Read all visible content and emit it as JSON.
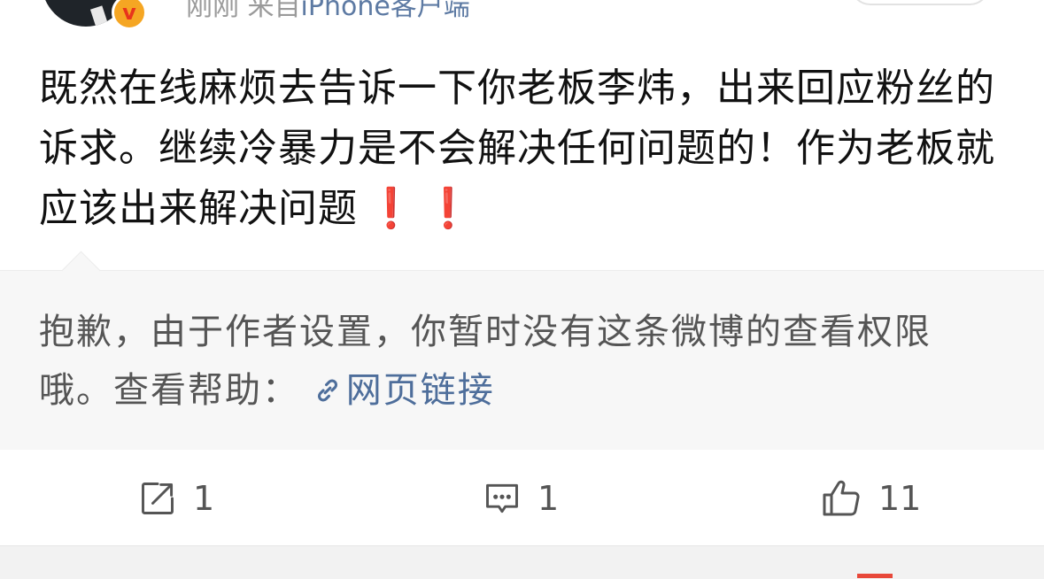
{
  "post": {
    "time": "刚刚",
    "source_prefix": "来自",
    "source": "iPhone客户端",
    "verified_mark": "v",
    "text": "既然在线麻烦去告诉一下你老板李炜，出来回应粉丝的诉求。继续冷暴力是不会解决任何问题的！作为老板就应该出来解决问题",
    "emoji": [
      "❗",
      "❗"
    ]
  },
  "notice": {
    "text": "抱歉，由于作者设置，你暂时没有这条微博的查看权限哦。查看帮助：",
    "link_label": "网页链接"
  },
  "actions": {
    "repost_count": "1",
    "comment_count": "1",
    "like_count": "11"
  },
  "colors": {
    "link": "#4e6e9b",
    "verified_badge": "#f5a623",
    "exclamation": "#e11b1b"
  },
  "icons": [
    "verified-icon",
    "link-icon",
    "repost-icon",
    "comment-icon",
    "like-icon"
  ]
}
